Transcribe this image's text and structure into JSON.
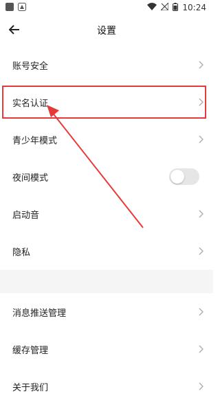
{
  "status_bar": {
    "time": "10:24"
  },
  "header": {
    "title": "设置"
  },
  "settings": {
    "items": [
      {
        "label": "账号安全"
      },
      {
        "label": "实名认证"
      },
      {
        "label": "青少年模式"
      },
      {
        "label": "夜间模式",
        "toggle_on": false
      },
      {
        "label": "启动音"
      },
      {
        "label": "隐私"
      }
    ],
    "items2": [
      {
        "label": "消息推送管理"
      },
      {
        "label": "缓存管理"
      },
      {
        "label": "关于我们"
      }
    ]
  },
  "annotation": {
    "color": "#e53a3a"
  }
}
